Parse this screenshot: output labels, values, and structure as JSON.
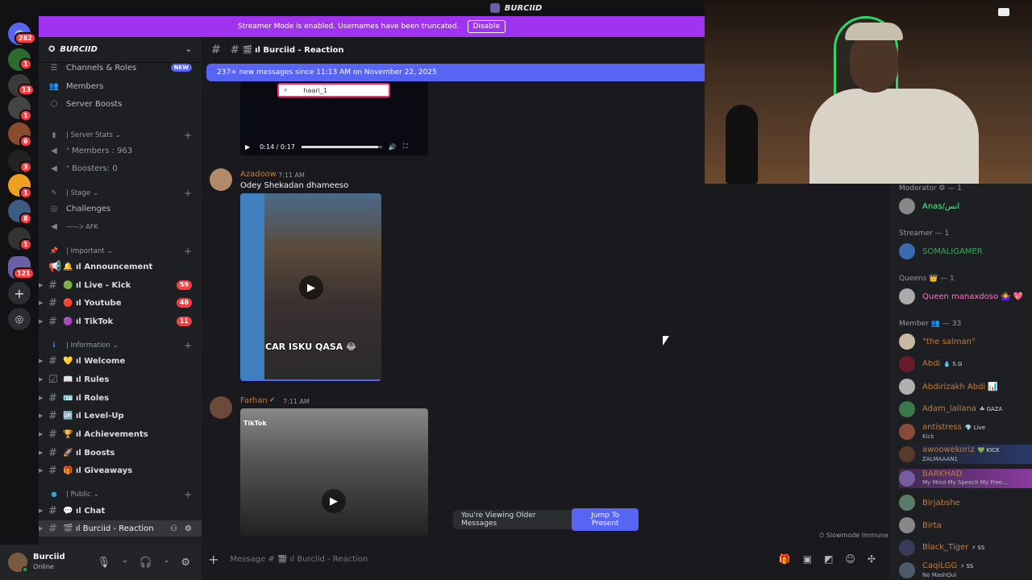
{
  "window": {
    "title": "BURCIID"
  },
  "banner": {
    "text": "Streamer Mode is enabled. Usernames have been truncated.",
    "button": "Disable"
  },
  "rail": {
    "badges": [
      "282",
      "1",
      "13",
      "1",
      "6",
      "3",
      "1",
      "8",
      "1",
      "121"
    ]
  },
  "guild": {
    "name": "BURCIID"
  },
  "sidebar": {
    "top_items": [
      {
        "label": "Channels & Roles",
        "badge": "NEW",
        "icon": "list-icon"
      },
      {
        "label": "Members",
        "icon": "members-icon"
      },
      {
        "label": "Server Boosts",
        "icon": "boost-icon"
      }
    ],
    "cat_stats": "| Server Stats",
    "stat_members": "ᐩ Members : 963",
    "stat_boosters": "ᐩ Boosters: 0",
    "cat_stage": "| Stage",
    "challenges": "Challenges",
    "afk": "——ᐳ AFK",
    "cat_important": "| Important",
    "cat_information": "| Information",
    "cat_public": "| Public",
    "channels_important": [
      {
        "emoji": "🔔",
        "label": "ıl Announcement",
        "count": ""
      },
      {
        "emoji": "🟢",
        "label": "ıl Live - Kick",
        "count": "59"
      },
      {
        "emoji": "🔴",
        "label": "ıl Youtube",
        "count": "48"
      },
      {
        "emoji": "🟣",
        "label": "ıl TikTok",
        "count": "11"
      }
    ],
    "channels_info": [
      {
        "emoji": "💛",
        "label": "ıl Welcome"
      },
      {
        "emoji": "📖",
        "label": "ıl Rules"
      },
      {
        "emoji": "🪪",
        "label": "ıl Roles"
      },
      {
        "emoji": "🆙",
        "label": "ıl Level-Up"
      },
      {
        "emoji": "🏆",
        "label": "ıl Achievements"
      },
      {
        "emoji": "🚀",
        "label": "ıl Boosts"
      },
      {
        "emoji": "🎁",
        "label": "ıl Giveaways"
      }
    ],
    "channels_public": [
      {
        "emoji": "💬",
        "label": "ıl Chat"
      },
      {
        "emoji": "🎬",
        "label": "ıl Burciid - Reaction"
      }
    ]
  },
  "user": {
    "name": "Burciid",
    "status": "Online"
  },
  "channel": {
    "header": "ıl Burciid - Reaction"
  },
  "new_messages": "237+ new messages since 11:13 AM on November 22, 2025",
  "video_top": {
    "search": "haari_1",
    "time": "0:14 / 0:17",
    "progress": 0.95
  },
  "messages": [
    {
      "user": "Azadoow",
      "time": "7:11 AM",
      "text": "Odey Shekadan dhameeso",
      "caption": "CAR ISKU QASA 😂"
    },
    {
      "user": "Farhan",
      "time": "7:11 AM",
      "text": "",
      "caption": "TikTok"
    }
  ],
  "older_bar": {
    "text": "You're Viewing Older Messages",
    "button": "Jump To Present"
  },
  "composer": {
    "placeholder": "Message # 🎬 ıl Burciid - Reaction"
  },
  "slowmode": "Slowmode Immune",
  "members": {
    "groups": [
      {
        "title": "Moderator ⚙ — 1"
      },
      {
        "title": "Streamer — 1"
      },
      {
        "title": "Queens 👑 — 1"
      },
      {
        "title": "Member 👥 — 33"
      }
    ],
    "list": [
      {
        "name": "Anas/انس",
        "color": "#57f287",
        "sub": "",
        "tag": ""
      },
      {
        "name": "SOMALIGAMER",
        "color": "#3ba55d",
        "sub": "",
        "tag": ""
      },
      {
        "name": "Queen manaxdoso 🤷‍♀️ 💖",
        "color": "#ff73c8",
        "sub": "",
        "tag": ""
      },
      {
        "name": "°the salman°",
        "color": "#c27c3e",
        "sub": "",
        "tag": ""
      },
      {
        "name": "Abdi",
        "color": "#c27c3e",
        "sub": "",
        "tag": "💧 S.G"
      },
      {
        "name": "Abdirizakh Abdi 📊",
        "color": "#c27c3e",
        "sub": "",
        "tag": ""
      },
      {
        "name": "Adam_lallana",
        "color": "#c27c3e",
        "sub": "",
        "tag": "☘ GAZA"
      },
      {
        "name": "antistress",
        "color": "#c27c3e",
        "sub": "Kick",
        "tag": "💎 Live"
      },
      {
        "name": "awoowekoriz",
        "color": "#c27c3e",
        "sub": "ZALMAAAN1",
        "tag": "💚 KICK"
      },
      {
        "name": "BARKHAD",
        "color": "#c27c3e",
        "sub": "My Mind My Speech My Free...",
        "tag": ""
      },
      {
        "name": "Birjabshe",
        "color": "#c27c3e",
        "sub": "",
        "tag": ""
      },
      {
        "name": "Birta",
        "color": "#c27c3e",
        "sub": "",
        "tag": ""
      },
      {
        "name": "Black_Tiger",
        "color": "#c27c3e",
        "sub": "",
        "tag": "⚡ SS"
      },
      {
        "name": "CaqiLGG",
        "color": "#c27c3e",
        "sub": "No MashQul",
        "tag": "⚡ SS"
      }
    ]
  }
}
